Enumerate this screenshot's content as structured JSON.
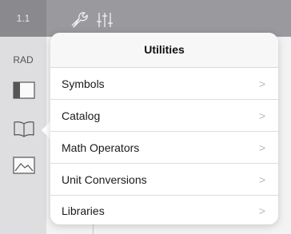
{
  "toolbar": {
    "page_label": "1.1",
    "icons": [
      "wrench-icon",
      "sliders-icon"
    ]
  },
  "sidebar": {
    "angle_mode": "RAD",
    "icons": [
      "template-icon",
      "book-icon",
      "gallery-icon"
    ]
  },
  "popover": {
    "title": "Utilities",
    "items": [
      {
        "label": "Symbols"
      },
      {
        "label": "Catalog"
      },
      {
        "label": "Math Operators"
      },
      {
        "label": "Unit Conversions"
      },
      {
        "label": "Libraries"
      }
    ],
    "chevron": ">"
  }
}
